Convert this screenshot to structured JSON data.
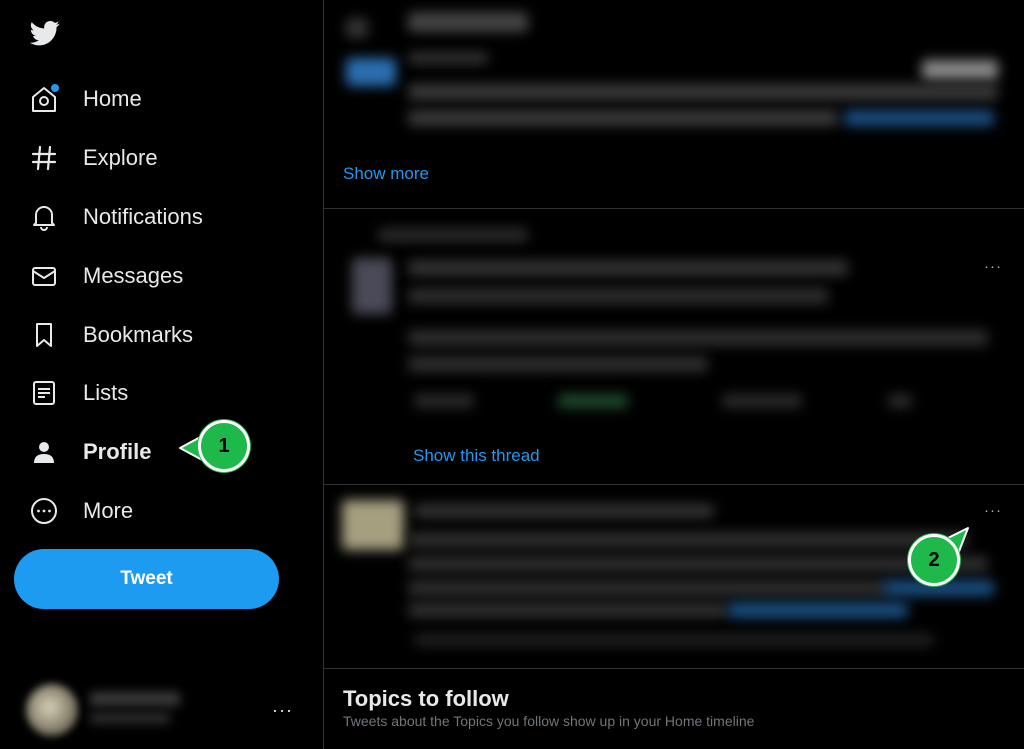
{
  "sidebar": {
    "logo_icon": "twitter-bird-icon",
    "nav": [
      {
        "label": "Home",
        "icon": "home-icon"
      },
      {
        "label": "Explore",
        "icon": "hashtag-icon"
      },
      {
        "label": "Notifications",
        "icon": "bell-icon"
      },
      {
        "label": "Messages",
        "icon": "envelope-icon"
      },
      {
        "label": "Bookmarks",
        "icon": "bookmark-icon"
      },
      {
        "label": "Lists",
        "icon": "list-icon"
      },
      {
        "label": "Profile",
        "icon": "person-icon"
      },
      {
        "label": "More",
        "icon": "more-circle-icon"
      }
    ],
    "tweet_label": "Tweet",
    "account_more": "···"
  },
  "feed": {
    "show_more": "Show more",
    "show_thread": "Show this thread",
    "more_dots": "···",
    "topics_title": "Topics to follow",
    "topics_subtitle": "Tweets about the Topics you follow show up in your Home timeline"
  },
  "callouts": {
    "first": "1",
    "second": "2"
  },
  "colors": {
    "accent": "#1d9bf0",
    "callout": "#1fb84a",
    "background": "#000000"
  }
}
